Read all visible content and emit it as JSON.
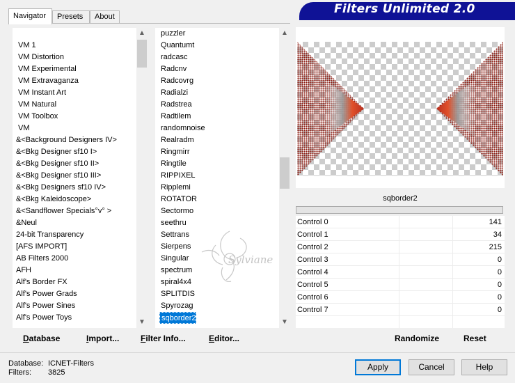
{
  "tabs": [
    {
      "label": "Navigator"
    },
    {
      "label": "Presets"
    },
    {
      "label": "About"
    }
  ],
  "app_title": "Filters Unlimited 2.0",
  "categories": [
    "VM 1",
    "VM Distortion",
    "VM Experimental",
    "VM Extravaganza",
    "VM Instant Art",
    "VM Natural",
    "VM Toolbox",
    "VM",
    "&<Background Designers IV>",
    "&<Bkg Designer sf10 I>",
    "&<Bkg Designer sf10 II>",
    "&<Bkg Designer sf10 III>",
    "&<Bkg Designers sf10 IV>",
    "&<Bkg Kaleidoscope>",
    "&<Sandflower Specials°v° >",
    "&Neul",
    "24-bit Transparency",
    "[AFS IMPORT]",
    "AB Filters 2000",
    "AFH",
    "Alf's Border FX",
    "Alf's Power Grads",
    "Alf's Power Sines",
    "Alf's Power Toys"
  ],
  "filters": [
    "puzzler",
    "Quantumt",
    "radcasc",
    "Radcnv",
    "Radcovrg",
    "Radialzi",
    "Radstrea",
    "Radtilem",
    "randomnoise",
    "Realradm",
    "Ringmirr",
    "Ringtile",
    "RIPPIXEL",
    "Ripplemi",
    "ROTATOR",
    "Sectormo",
    "seethru",
    "Settrans",
    "Sierpens",
    "Singular",
    "spectrum",
    "spiral4x4",
    "SPLITDIS",
    "Spyrozag",
    "sqborder2"
  ],
  "selected_filter": "sqborder2",
  "controls": [
    {
      "label": "Control 0",
      "value": "141"
    },
    {
      "label": "Control 1",
      "value": "34"
    },
    {
      "label": "Control 2",
      "value": "215"
    },
    {
      "label": "Control 3",
      "value": "0"
    },
    {
      "label": "Control 4",
      "value": "0"
    },
    {
      "label": "Control 5",
      "value": "0"
    },
    {
      "label": "Control 6",
      "value": "0"
    },
    {
      "label": "Control 7",
      "value": "0"
    }
  ],
  "bottom_buttons": {
    "database": "Database",
    "import": "Import...",
    "filter_info": "Filter Info...",
    "editor": "Editor...",
    "randomize": "Randomize",
    "reset": "Reset"
  },
  "status": {
    "database_label": "Database:",
    "database_value": "ICNET-Filters",
    "filters_label": "Filters:",
    "filters_value": "3825"
  },
  "dialog_buttons": {
    "apply": "Apply",
    "cancel": "Cancel",
    "help": "Help"
  },
  "watermark": "Sylviane",
  "colors": {
    "banner": "#0f1296",
    "selection": "#0078d7"
  }
}
